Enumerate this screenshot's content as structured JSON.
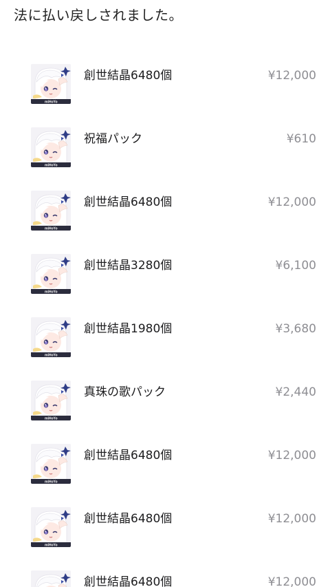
{
  "notice": {
    "text": "法に払い戻しされました。"
  },
  "app_icon": "paimon-app-icon",
  "purchases": [
    {
      "name": "創世結晶6480個",
      "price": "¥12,000"
    },
    {
      "name": "祝福パック",
      "price": "¥610"
    },
    {
      "name": "創世結晶6480個",
      "price": "¥12,000"
    },
    {
      "name": "創世結晶3280個",
      "price": "¥6,100"
    },
    {
      "name": "創世結晶1980個",
      "price": "¥3,680"
    },
    {
      "name": "真珠の歌パック",
      "price": "¥2,440"
    },
    {
      "name": "創世結晶6480個",
      "price": "¥12,000"
    },
    {
      "name": "創世結晶6480個",
      "price": "¥12,000"
    },
    {
      "name": "創世結晶6480個",
      "price": "¥12,000"
    }
  ],
  "icon_badge_text": "miHoYo",
  "colors": {
    "text": "#1c1c1e",
    "price": "#8e8e93",
    "background": "#ffffff"
  }
}
